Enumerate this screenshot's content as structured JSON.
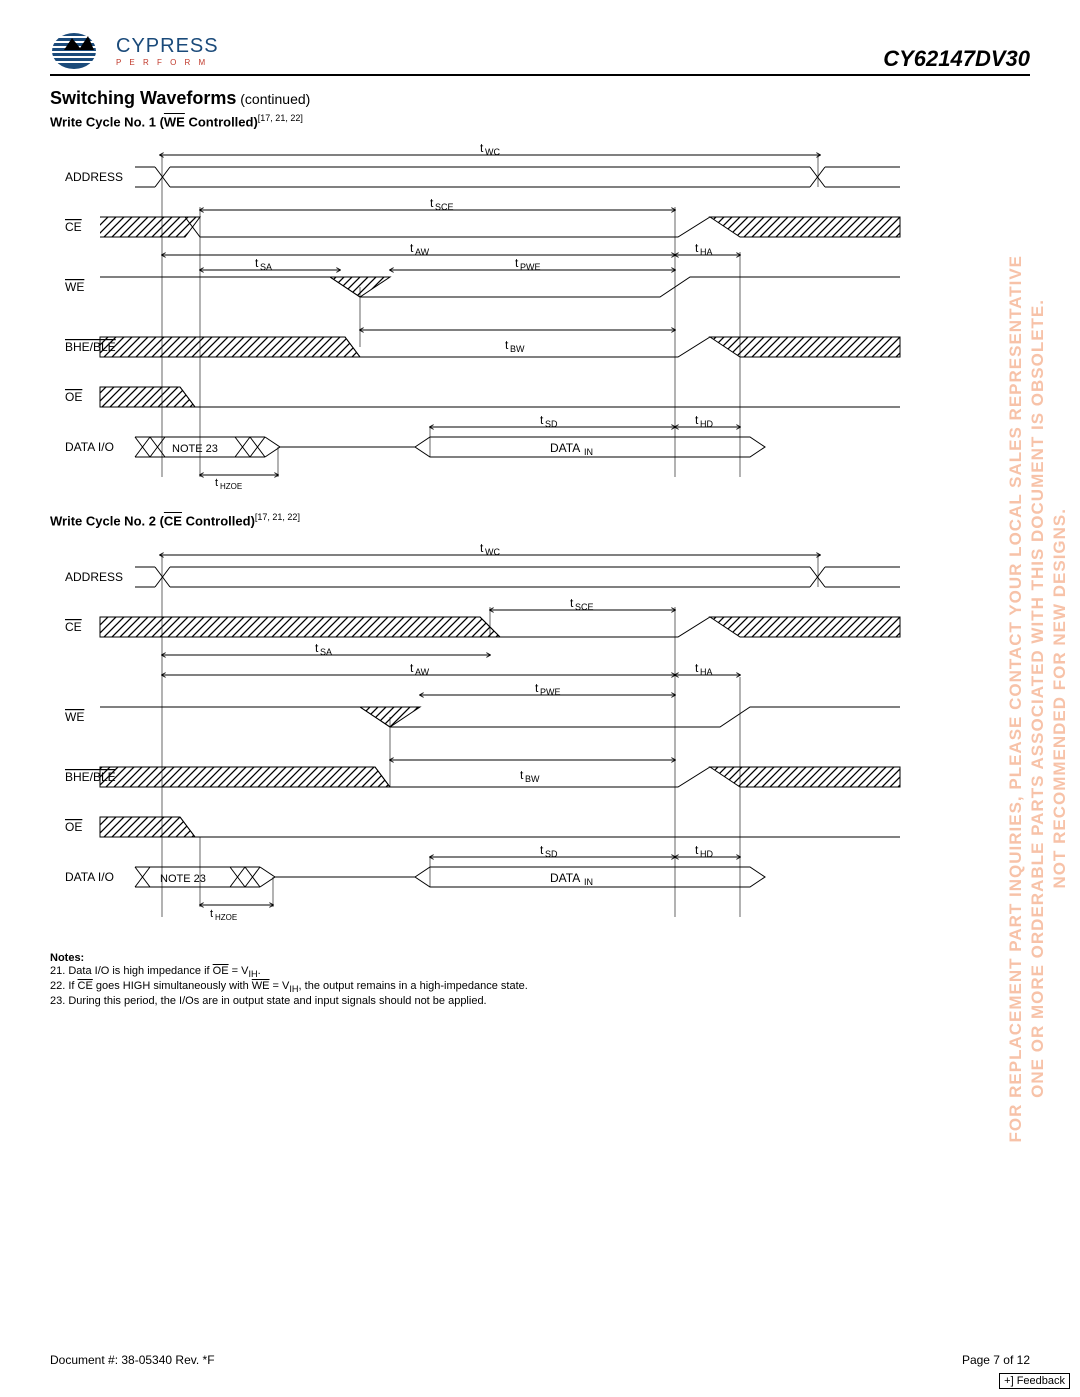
{
  "header": {
    "logo_name": "CYPRESS",
    "logo_sub": "P E R F O R M",
    "part_number": "CY62147DV30"
  },
  "section": {
    "title_main": "Switching Waveforms",
    "title_cont": " (continued)"
  },
  "diagram1": {
    "title_prefix": "Write Cycle No. 1 (",
    "title_overline": "WE",
    "title_suffix": " Controlled)",
    "title_refs": "[17, 21, 22]",
    "labels": {
      "address": "ADDRESS",
      "ce": "CE",
      "we": "WE",
      "bhe_ble": "BHE/BLE",
      "oe": "OE",
      "data_io": "DATA I/O",
      "data_in": "DATA",
      "data_in_sub": "IN",
      "note23": "NOTE 23"
    },
    "timings": {
      "twc": "WC",
      "tsce": "SCE",
      "taw": "AW",
      "tha": "HA",
      "tsa": "SA",
      "tpwe": "PWE",
      "tbw": "BW",
      "tsd": "SD",
      "thd": "HD",
      "thzoe": "HZOE"
    }
  },
  "diagram2": {
    "title_prefix": "Write Cycle No. 2 (",
    "title_overline": "CE",
    "title_suffix": " Controlled)",
    "title_refs": "[17, 21, 22]",
    "labels": {
      "address": "ADDRESS",
      "ce": "CE",
      "we": "WE",
      "bhe_ble": "BHE/BLE",
      "oe": "OE",
      "data_io": "DATA  I/O",
      "data_in": "DATA",
      "data_in_sub": "IN",
      "note23": "NOTE 23"
    },
    "timings": {
      "twc": "WC",
      "tsce": "SCE",
      "taw": "AW",
      "tha": "HA",
      "tsa": "SA",
      "tpwe": "PWE",
      "tbw": "BW",
      "tsd": "SD",
      "thd": "HD",
      "thzoe": "HZOE"
    }
  },
  "notes": {
    "heading": "Notes:",
    "n21_a": "21. Data I/O is high impedance if ",
    "n21_over": "OE",
    "n21_b": " = V",
    "n21_sub": "IH",
    "n21_c": ".",
    "n22_a": "22. If ",
    "n22_over1": "CE",
    "n22_b": " goes HIGH simultaneously with ",
    "n22_over2": "WE",
    "n22_c": " = V",
    "n22_sub": "IH",
    "n22_d": ", the output remains in a high-impedance state.",
    "n23": "23. During this period, the I/Os are in output state and input signals should not be applied."
  },
  "footer": {
    "doc": "Document #: 38-05340 Rev. *F",
    "page": "Page 7 of 12"
  },
  "watermark": {
    "line1": "NOT RECOMMENDED FOR NEW DESIGNS.",
    "line2": "ONE OR MORE ORDERABLE PARTS ASSOCIATED WITH THIS DOCUMENT IS OBSOLETE.",
    "line3": "FOR REPLACEMENT PART INQUIRIES, PLEASE CONTACT YOUR LOCAL SALES REPRESENTATIVE"
  },
  "feedback": "+] Feedback"
}
